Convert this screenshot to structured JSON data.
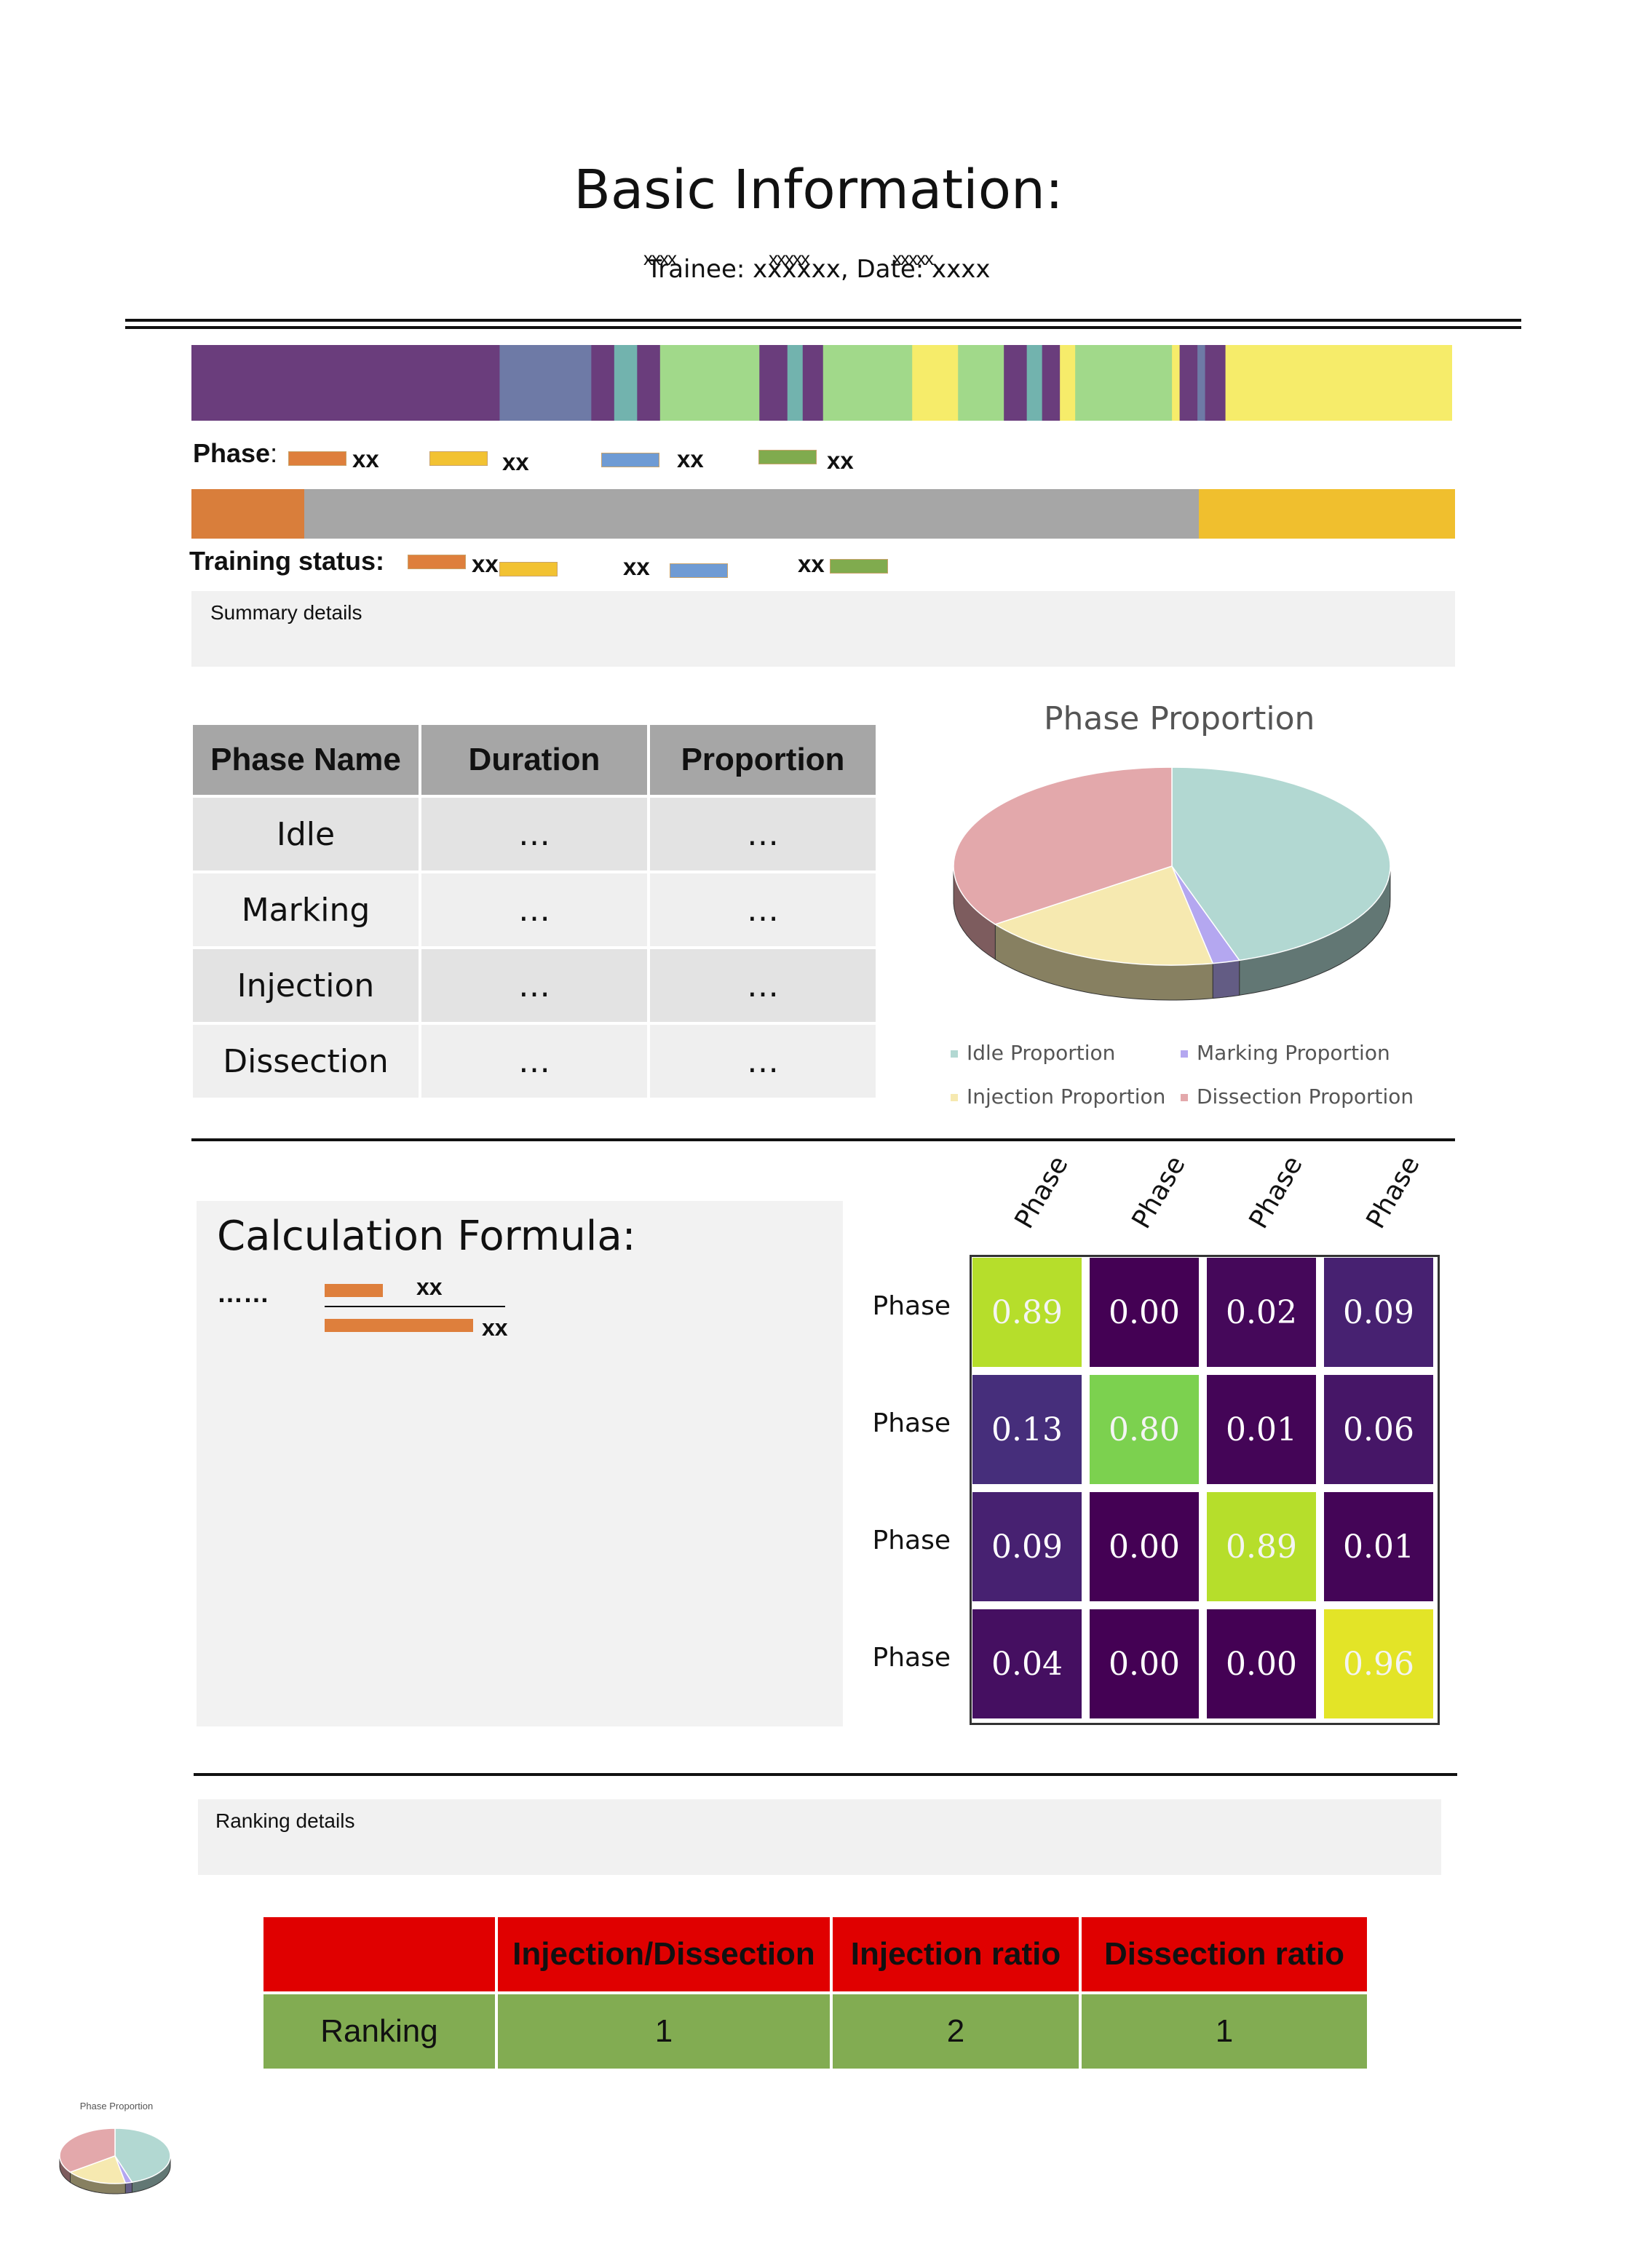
{
  "header": {
    "title": "Basic Information:",
    "subtitle": "Trainee: xxxxxx, Date: xxxx",
    "subtitle_overlay": [
      "xxxx",
      "xxxxx",
      "xxxxx"
    ]
  },
  "timeline": {
    "colors": {
      "purple": "#6a3d7c",
      "slate": "#6e7aa6",
      "teal": "#72b3ae",
      "green": "#a1d98a",
      "yellow": "#f6ec6a"
    },
    "segments": [
      [
        "purple",
        0.242
      ],
      [
        "slate",
        0.072
      ],
      [
        "purple",
        0.018
      ],
      [
        "teal",
        0.018
      ],
      [
        "purple",
        0.018
      ],
      [
        "green",
        0.078
      ],
      [
        "purple",
        0.022
      ],
      [
        "teal",
        0.012
      ],
      [
        "purple",
        0.016
      ],
      [
        "green",
        0.07
      ],
      [
        "yellow",
        0.036
      ],
      [
        "green",
        0.036
      ],
      [
        "purple",
        0.018
      ],
      [
        "teal",
        0.012
      ],
      [
        "purple",
        0.014
      ],
      [
        "yellow",
        0.012
      ],
      [
        "green",
        0.076
      ],
      [
        "yellow",
        0.006
      ],
      [
        "purple",
        0.014
      ],
      [
        "slate",
        0.006
      ],
      [
        "purple",
        0.016
      ],
      [
        "yellow",
        0.178
      ]
    ]
  },
  "phase_legend": {
    "label": "Phase",
    "colon": ":",
    "items": [
      {
        "color": "#de7f3c",
        "text": "xx"
      },
      {
        "color": "#f2c232",
        "text": "xx"
      },
      {
        "color": "#6f9bd4",
        "text": "xx"
      },
      {
        "color": "#80ab4e",
        "text": "xx"
      }
    ]
  },
  "status_bar": {
    "segments": [
      {
        "color": "#d97e3b",
        "fraction": 0.089
      },
      {
        "color": "#a6a6a6",
        "fraction": 0.708
      },
      {
        "color": "#f0bf2e",
        "fraction": 0.203
      }
    ]
  },
  "status_legend": {
    "label": "Training status",
    "colon": ":",
    "items": [
      {
        "color": "#de7f3c",
        "text": "xx"
      },
      {
        "color": "#f2c232",
        "text": "xx"
      },
      {
        "color": "#6f9bd4",
        "text": "xx"
      },
      {
        "color": "#80ab4e",
        "text": "xx"
      }
    ]
  },
  "summary": {
    "label": "Summary details"
  },
  "phase_table": {
    "headers": [
      "Phase Name",
      "Duration",
      "Proportion"
    ],
    "rows": [
      [
        "Idle",
        "…",
        "…"
      ],
      [
        "Marking",
        "…",
        "…"
      ],
      [
        "Injection",
        "…",
        "…"
      ],
      [
        "Dissection",
        "…",
        "…"
      ]
    ]
  },
  "pie": {
    "title": "Phase Proportion",
    "legend": [
      {
        "name": "Idle Proportion",
        "color": "#b2d8d2"
      },
      {
        "name": "Marking Proportion",
        "color": "#b4a7f0"
      },
      {
        "name": "Injection Proportion",
        "color": "#f6e9b0"
      },
      {
        "name": "Dissection Proportion",
        "color": "#e3a8ab"
      }
    ]
  },
  "formula": {
    "title": "Calculation Formula:",
    "dots": "……",
    "num": "xx",
    "den": "xx",
    "bar_color": "#de7f3c"
  },
  "chart_data": [
    {
      "type": "pie",
      "title": "Phase Proportion",
      "categories": [
        "Idle Proportion",
        "Marking Proportion",
        "Injection Proportion",
        "Dissection Proportion"
      ],
      "values": [
        0.45,
        0.02,
        0.18,
        0.35
      ]
    },
    {
      "type": "heatmap",
      "row_labels": [
        "Phase",
        "Phase",
        "Phase",
        "Phase"
      ],
      "col_labels": [
        "Phase",
        "Phase",
        "Phase",
        "Phase"
      ],
      "values": [
        [
          0.89,
          0.0,
          0.02,
          0.09
        ],
        [
          0.13,
          0.8,
          0.01,
          0.06
        ],
        [
          0.09,
          0.0,
          0.89,
          0.01
        ],
        [
          0.04,
          0.0,
          0.0,
          0.96
        ]
      ],
      "text": [
        [
          "0.89",
          "0.00",
          "0.02",
          "0.09"
        ],
        [
          "0.13",
          "0.80",
          "0.01",
          "0.06"
        ],
        [
          "0.09",
          "0.00",
          "0.89",
          "0.01"
        ],
        [
          "0.04",
          "0.00",
          "0.00",
          "0.96"
        ]
      ],
      "colormap": "viridis"
    }
  ],
  "ranking": {
    "label": "Ranking details",
    "headers": [
      "",
      "Injection/Dissection",
      "Injection ratio",
      "Dissection ratio"
    ],
    "row": [
      "Ranking",
      "1",
      "2",
      "1"
    ]
  },
  "thumbnail": {
    "title": "Phase Proportion"
  }
}
